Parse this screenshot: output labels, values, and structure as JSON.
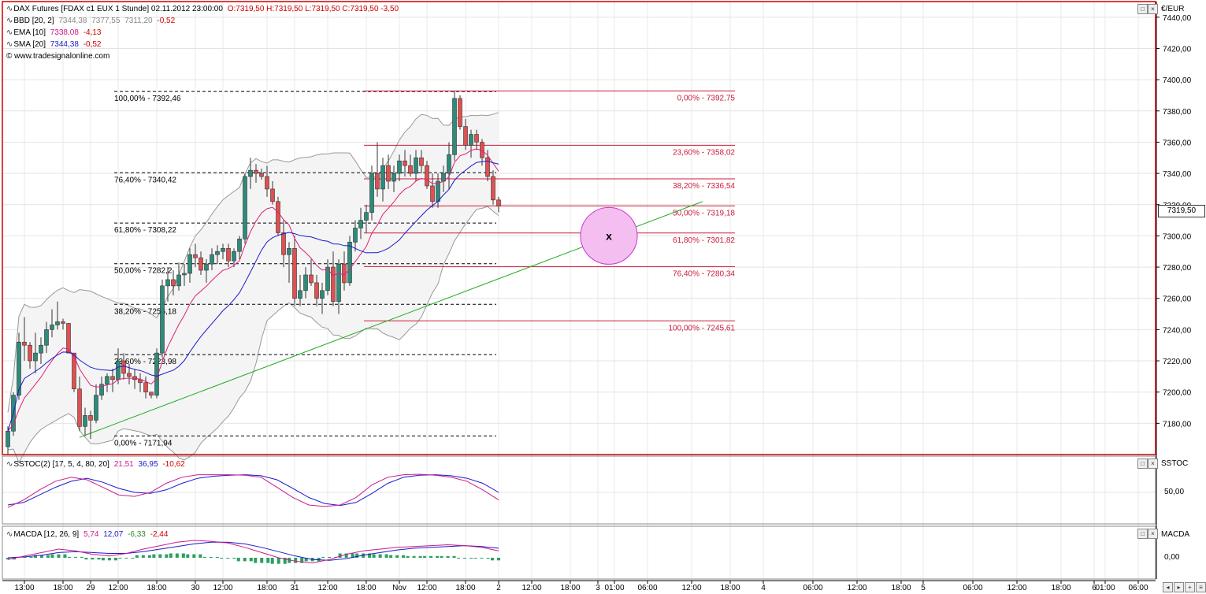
{
  "legend": {
    "title": "DAX Futures [FDAX c1 EUX  1 Stunde] 02.11.2012 23:00:00",
    "ohlc": "O:7319,50 H:7319,50 L:7319,50 C:7319,50 -3,50",
    "bbd_label": "BBD [20, 2]",
    "bbd_v1": "7344,38",
    "bbd_v2": "7377,55",
    "bbd_v3": "7311,20",
    "bbd_v4": "-0,52",
    "ema_label": "EMA [10]",
    "ema_v1": "7338,08",
    "ema_v2": "-4,13",
    "sma_label": "SMA [20]",
    "sma_v1": "7344,38",
    "sma_v2": "-0,52",
    "website": "© www.tradesignalonline.com"
  },
  "sstoc": {
    "label": "SSTOC(2) [17, 5, 4, 80, 20]",
    "v1": "21,51",
    "v2": "36,95",
    "v3": "-10,62",
    "axis_label": "SSTOC",
    "tick": "50,00"
  },
  "macd": {
    "label": "MACDA [12, 26, 9]",
    "v1": "5,74",
    "v2": "12,07",
    "v3": "-6,33",
    "v4": "-2,44",
    "axis_label": "MACDA",
    "tick": "0,00"
  },
  "price_axis": {
    "currency": "€/EUR",
    "last": "7319,50"
  },
  "colors": {
    "frame": "#cc0000",
    "up": "#2e8b7a",
    "down": "#e05050",
    "fib_red": "#cc1a3a",
    "trend": "#22aa22",
    "ema": "#e0207a",
    "sma": "#1a1acc",
    "bb": "#999999",
    "circle_fill": "#f4bff0",
    "circle_stroke": "#cc33cc"
  },
  "chart_data": {
    "type": "candlestick",
    "interval": "1 Stunde",
    "ylim": [
      7160,
      7450
    ],
    "y_ticks": [
      "7440,00",
      "7420,00",
      "7400,00",
      "7380,00",
      "7360,00",
      "7340,00",
      "7320,00",
      "7300,00",
      "7280,00",
      "7260,00",
      "7240,00",
      "7220,00",
      "7200,00",
      "7180,00"
    ],
    "x_ticks": [
      "13:00",
      "18:00",
      "29",
      "12:00",
      "18:00",
      "30",
      "12:00",
      "18:00",
      "31",
      "12:00",
      "18:00",
      "Nov",
      "12:00",
      "18:00",
      "2",
      "12:00",
      "18:00",
      "3",
      "01:00",
      "06:00",
      "12:00",
      "18:00",
      "4",
      "06:00",
      "12:00",
      "18:00",
      "5",
      "06:00",
      "12:00",
      "18:00",
      "6",
      "01:00",
      "06:00"
    ],
    "x_tick_index": [
      3,
      10,
      15,
      20,
      27,
      34,
      39,
      47,
      52,
      58,
      65,
      71,
      76,
      83,
      89,
      95,
      102,
      107,
      110,
      116,
      124,
      131,
      137,
      146,
      154,
      162,
      166,
      175,
      183,
      191,
      197,
      199,
      205
    ],
    "candles": [
      [
        7165,
        7178,
        7160,
        7175
      ],
      [
        7175,
        7200,
        7172,
        7198
      ],
      [
        7198,
        7238,
        7195,
        7232
      ],
      [
        7232,
        7248,
        7220,
        7230
      ],
      [
        7230,
        7232,
        7215,
        7220
      ],
      [
        7220,
        7238,
        7212,
        7225
      ],
      [
        7225,
        7235,
        7218,
        7230
      ],
      [
        7230,
        7245,
        7225,
        7240
      ],
      [
        7240,
        7253,
        7235,
        7243
      ],
      [
        7243,
        7258,
        7240,
        7245
      ],
      [
        7245,
        7247,
        7240,
        7244
      ],
      [
        7244,
        7244,
        7225,
        7225
      ],
      [
        7225,
        7225,
        7200,
        7202
      ],
      [
        7202,
        7210,
        7175,
        7178
      ],
      [
        7178,
        7190,
        7172,
        7185
      ],
      [
        7185,
        7188,
        7170,
        7182
      ],
      [
        7182,
        7205,
        7180,
        7198
      ],
      [
        7198,
        7210,
        7195,
        7205
      ],
      [
        7205,
        7212,
        7200,
        7210
      ],
      [
        7210,
        7215,
        7200,
        7208
      ],
      [
        7208,
        7228,
        7205,
        7220
      ],
      [
        7220,
        7225,
        7208,
        7212
      ],
      [
        7212,
        7218,
        7205,
        7210
      ],
      [
        7210,
        7215,
        7202,
        7208
      ],
      [
        7208,
        7212,
        7200,
        7206
      ],
      [
        7206,
        7210,
        7196,
        7200
      ],
      [
        7200,
        7200,
        7196,
        7198
      ],
      [
        7198,
        7228,
        7196,
        7225
      ],
      [
        7225,
        7272,
        7222,
        7268
      ],
      [
        7268,
        7280,
        7258,
        7272
      ],
      [
        7272,
        7278,
        7262,
        7268
      ],
      [
        7268,
        7283,
        7265,
        7275
      ],
      [
        7275,
        7282,
        7268,
        7276
      ],
      [
        7276,
        7292,
        7270,
        7288
      ],
      [
        7288,
        7295,
        7280,
        7286
      ],
      [
        7286,
        7290,
        7275,
        7278
      ],
      [
        7278,
        7285,
        7270,
        7282
      ],
      [
        7282,
        7292,
        7278,
        7288
      ],
      [
        7288,
        7294,
        7282,
        7290
      ],
      [
        7290,
        7295,
        7285,
        7292
      ],
      [
        7292,
        7295,
        7280,
        7284
      ],
      [
        7284,
        7292,
        7280,
        7290
      ],
      [
        7290,
        7300,
        7285,
        7298
      ],
      [
        7298,
        7340,
        7295,
        7338
      ],
      [
        7338,
        7350,
        7330,
        7342
      ],
      [
        7342,
        7346,
        7334,
        7340
      ],
      [
        7340,
        7343,
        7336,
        7338
      ],
      [
        7338,
        7345,
        7325,
        7330
      ],
      [
        7330,
        7335,
        7320,
        7322
      ],
      [
        7322,
        7325,
        7300,
        7302
      ],
      [
        7302,
        7310,
        7280,
        7288
      ],
      [
        7288,
        7296,
        7270,
        7292
      ],
      [
        7292,
        7300,
        7255,
        7260
      ],
      [
        7260,
        7275,
        7255,
        7265
      ],
      [
        7265,
        7280,
        7260,
        7275
      ],
      [
        7275,
        7285,
        7268,
        7270
      ],
      [
        7270,
        7275,
        7255,
        7260
      ],
      [
        7260,
        7270,
        7250,
        7265
      ],
      [
        7265,
        7285,
        7262,
        7280
      ],
      [
        7280,
        7290,
        7255,
        7258
      ],
      [
        7258,
        7285,
        7250,
        7282
      ],
      [
        7282,
        7290,
        7265,
        7270
      ],
      [
        7270,
        7300,
        7268,
        7296
      ],
      [
        7296,
        7310,
        7290,
        7305
      ],
      [
        7305,
        7318,
        7298,
        7310
      ],
      [
        7310,
        7320,
        7302,
        7315
      ],
      [
        7315,
        7345,
        7310,
        7340
      ],
      [
        7340,
        7360,
        7325,
        7330
      ],
      [
        7330,
        7350,
        7322,
        7345
      ],
      [
        7345,
        7352,
        7330,
        7335
      ],
      [
        7335,
        7345,
        7328,
        7340
      ],
      [
        7340,
        7352,
        7335,
        7348
      ],
      [
        7348,
        7355,
        7338,
        7345
      ],
      [
        7345,
        7352,
        7338,
        7340
      ],
      [
        7340,
        7355,
        7335,
        7350
      ],
      [
        7350,
        7355,
        7340,
        7345
      ],
      [
        7345,
        7348,
        7330,
        7332
      ],
      [
        7332,
        7340,
        7318,
        7322
      ],
      [
        7322,
        7340,
        7318,
        7335
      ],
      [
        7335,
        7345,
        7328,
        7340
      ],
      [
        7340,
        7360,
        7330,
        7352
      ],
      [
        7352,
        7393,
        7348,
        7388
      ],
      [
        7388,
        7390,
        7368,
        7370
      ],
      [
        7370,
        7375,
        7355,
        7358
      ],
      [
        7358,
        7368,
        7350,
        7365
      ],
      [
        7365,
        7368,
        7355,
        7360
      ],
      [
        7360,
        7362,
        7345,
        7350
      ],
      [
        7350,
        7355,
        7335,
        7338
      ],
      [
        7338,
        7342,
        7320,
        7323
      ],
      [
        7323,
        7325,
        7315,
        7319
      ]
    ],
    "fib_left": [
      {
        "label": "100,00% - 7392,46",
        "value": 7392.46
      },
      {
        "label": "76,40% - 7340,42",
        "value": 7340.42
      },
      {
        "label": "61,80% - 7308,22",
        "value": 7308.22
      },
      {
        "label": "50,00% - 7282,2",
        "value": 7282.2
      },
      {
        "label": "38,20% - 7256,18",
        "value": 7256.18
      },
      {
        "label": "23,60% - 7223,98",
        "value": 7223.98
      },
      {
        "label": "0,00% - 7171,94",
        "value": 7171.94
      }
    ],
    "fib_right": [
      {
        "label": "0,00% - 7392,75",
        "value": 7392.75
      },
      {
        "label": "23,60% - 7358,02",
        "value": 7358.02
      },
      {
        "label": "38,20% - 7336,54",
        "value": 7336.54
      },
      {
        "label": "50,00% - 7319,18",
        "value": 7319.18
      },
      {
        "label": "61,80% - 7301,82",
        "value": 7301.82
      },
      {
        "label": "76,40% - 7280,34",
        "value": 7280.34
      },
      {
        "label": "100,00% - 7245,61",
        "value": 7245.61
      }
    ],
    "trendline": [
      [
        13,
        7171
      ],
      [
        126,
        7322
      ]
    ],
    "target_marker": {
      "candle": 109,
      "value": 7300,
      "label": "x"
    },
    "sstoc": {
      "k": [
        20,
        35,
        55,
        72,
        80,
        75,
        60,
        45,
        42,
        50,
        68,
        80,
        85,
        85,
        85,
        84,
        80,
        60,
        40,
        25,
        22,
        25,
        40,
        65,
        80,
        85,
        86,
        84,
        80,
        72,
        55,
        35
      ],
      "d": [
        25,
        30,
        45,
        60,
        72,
        78,
        70,
        58,
        50,
        48,
        55,
        68,
        78,
        82,
        84,
        85,
        83,
        75,
        58,
        40,
        28,
        24,
        30,
        48,
        68,
        80,
        84,
        85,
        83,
        78,
        68,
        50
      ]
    },
    "macd": {
      "macd": [
        -2,
        2,
        6,
        10,
        8,
        4,
        2,
        5,
        10,
        14,
        18,
        20,
        19,
        17,
        12,
        6,
        0,
        -4,
        -6,
        -2,
        4,
        8,
        10,
        12,
        13,
        14,
        15,
        14,
        12,
        8
      ],
      "signal": [
        0,
        1,
        3,
        6,
        7,
        6,
        5,
        5,
        7,
        10,
        13,
        16,
        18,
        18,
        16,
        12,
        7,
        2,
        -2,
        -3,
        -1,
        3,
        6,
        9,
        11,
        12,
        13,
        14,
        13,
        11
      ],
      "hist": [
        -2,
        1,
        3,
        4,
        1,
        -2,
        -3,
        0,
        3,
        4,
        5,
        4,
        1,
        -1,
        -4,
        -6,
        -7,
        -6,
        -4,
        1,
        5,
        5,
        4,
        3,
        2,
        2,
        2,
        0,
        -1,
        -3
      ]
    }
  }
}
